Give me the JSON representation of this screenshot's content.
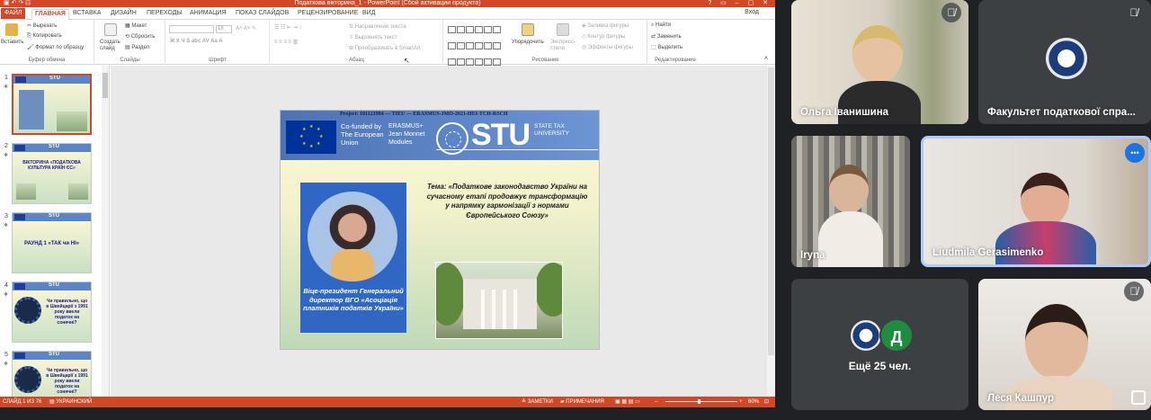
{
  "powerpoint": {
    "title": "Податкова вікторина_1 - PowerPoint (Сбой активации продукта)",
    "window_buttons": "?  ▭  –  ▢  ✕",
    "tabs": [
      {
        "label": "ФАЙЛ"
      },
      {
        "label": "ГЛАВНАЯ"
      },
      {
        "label": "ВСТАВКА"
      },
      {
        "label": "ДИЗАЙН"
      },
      {
        "label": "ПЕРЕХОДЫ"
      },
      {
        "label": "АНИМАЦИЯ"
      },
      {
        "label": "ПОКАЗ СЛАЙДОВ"
      },
      {
        "label": "РЕЦЕНЗИРОВАНИЕ"
      },
      {
        "label": "ВИД"
      }
    ],
    "sign_in": "Вход",
    "ribbon": {
      "paste": "Вставить",
      "cut": "Вырезать",
      "copy": "Копировать",
      "format_painter": "Формат по образцу",
      "clipboard": "Буфер обмена",
      "new_slide": "Создать слайд",
      "layout": "Макет",
      "reset": "Сбросить",
      "section": "Раздел",
      "slides": "Слайды",
      "font_size": "18",
      "font_group": "Шрифт",
      "text_direction": "Направление текста",
      "align_text": "Выровнять текст",
      "smartart": "Преобразовать в SmartArt",
      "paragraph": "Абзац",
      "arrange": "Упорядочить",
      "quick_styles": "Экспресс-стили",
      "shape_fill": "Заливка фигуры",
      "shape_outline": "Контур фигуры",
      "shape_effects": "Эффекты фигуры",
      "drawing": "Рисование",
      "find": "Найти",
      "replace": "Заменить",
      "select": "Выделить",
      "editing": "Редактирование"
    },
    "thumbnails": [
      {
        "num": "1",
        "text": ""
      },
      {
        "num": "2",
        "text": "ВІКТОРИНА «ПОДАТКОВА КУЛЬТУРА КРАЇН ЄС»"
      },
      {
        "num": "3",
        "text": "РАУНД 1 «ТАК чи НІ»"
      },
      {
        "num": "4",
        "text": "Чи правильно, що в Швейцарії з 1991 року ввели податок на сонячні?"
      },
      {
        "num": "5",
        "text": "Чи правильно, що в Швейцарії з 1991 року ввели податок на сонячні?"
      }
    ],
    "slide": {
      "project": "Project: 101121984 — TIEU — ERASMUS-JMO-2021-HEI-TCH-RSCH",
      "cofunded": "Co-funded by The European Union",
      "erasmus": "ERASMUS+ Jean Monnet Modules",
      "stu": "STU",
      "stu_full": "STATE TAX UNIVERSITY",
      "topic": "Тема: «Податкове законодавство України на сучасному етапі продовжує трансформацію у напрямку гармонізації з нормами Європейського Союзу»",
      "vp_caption": "Віце-президент Генеральний директор ВГО «Асоціація платників податків України»"
    },
    "status": {
      "slide_of": "СЛАЙД 1 ИЗ 76",
      "language": "УКРАИНСКИЙ",
      "notes": "ЗАМЕТКИ",
      "comments": "ПРИМЕЧАНИЯ",
      "zoom": "60%"
    }
  },
  "meet": {
    "participants": [
      {
        "name": "Ольга Іванишина",
        "muted": true
      },
      {
        "name": "Факультет податкової спра...",
        "muted": true
      },
      {
        "name": "Iryna",
        "muted": false
      },
      {
        "name": "Liudmila Gerasimenko",
        "muted": false
      },
      {
        "name": "Ещё 25 чел.",
        "avatar_letter": "Д",
        "avatar_color": "#1e8e3e"
      },
      {
        "name": "Леся Кашпур",
        "muted": true
      }
    ],
    "more_icon": "•••"
  },
  "colors": {
    "ppt_accent": "#d24726",
    "meet_bg": "#202124",
    "meet_tile": "#3c4043",
    "speaker_highlight": "#aecbfa"
  }
}
